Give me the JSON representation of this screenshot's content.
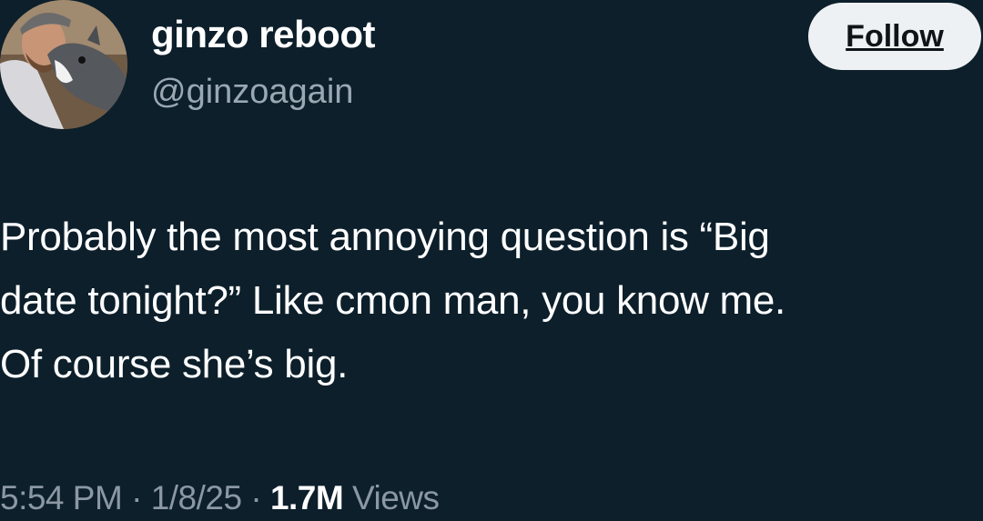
{
  "user": {
    "display_name": "ginzo reboot",
    "handle": "@ginzoagain",
    "follow_label": "Follow"
  },
  "tweet": {
    "lines": [
      "Probably the most annoying question is “Big",
      "date tonight?” Like cmon man, you know me.",
      "Of course she’s big."
    ]
  },
  "meta": {
    "time": "5:54 PM",
    "sep1": " · ",
    "date": "1/8/25",
    "sep2": " · ",
    "views_count": "1.7M",
    "views_label": " Views"
  },
  "colors": {
    "background": "#0c1f2b",
    "text": "#ffffff",
    "muted": "#8b98a4",
    "follow_bg": "#eef1f3"
  }
}
